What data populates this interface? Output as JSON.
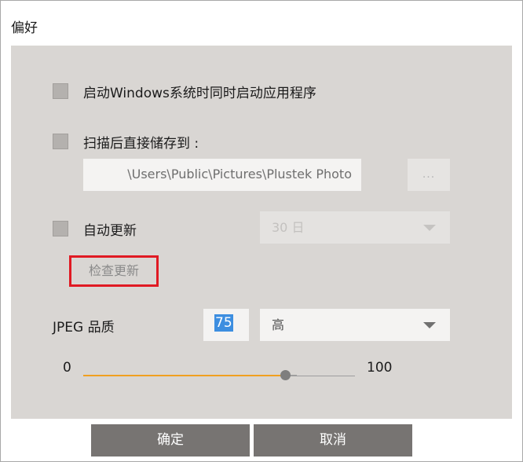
{
  "dialog": {
    "title": "偏好"
  },
  "options": {
    "startup_label": "启动Windows系统时同时启动应用程序",
    "startup_checked": false,
    "save_label": "扫描后直接储存到 :",
    "save_checked": false,
    "save_path": "\\Users\\Public\\Pictures\\Plustek Photo",
    "browse_label": "...",
    "auto_update_label": "自动更新",
    "auto_update_checked": false,
    "update_frequency": "30 日",
    "check_update_label": "检查更新"
  },
  "quality": {
    "label": "JPEG 品质",
    "value": "75",
    "level": "高",
    "min": "0",
    "max": "100",
    "slider_value": 75
  },
  "footer": {
    "ok_label": "确定",
    "cancel_label": "取消"
  },
  "colors": {
    "accent": "#f0a020",
    "selection": "#3d8ee0",
    "highlight_border": "#e01a23",
    "button": "#777472",
    "panel": "#d9d6d3"
  }
}
